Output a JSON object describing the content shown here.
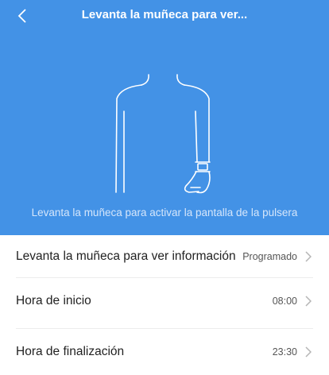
{
  "header": {
    "title": "Levanta la muñeca para ver...",
    "back_icon": "chevron-left-icon"
  },
  "hero": {
    "background": "#4392e6",
    "hint": "Levanta la muñeca para activar la pantalla de la pulsera"
  },
  "settings": [
    {
      "label": "Levanta la muñeca para ver información",
      "value": "Programado"
    },
    {
      "label": "Hora de inicio",
      "value": "08:00"
    },
    {
      "label": "Hora de finalización",
      "value": "23:30"
    }
  ]
}
